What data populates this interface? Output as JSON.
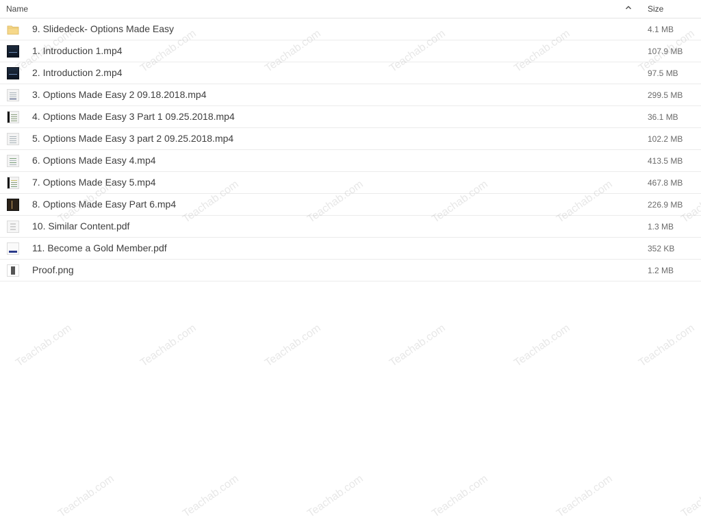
{
  "header": {
    "name_label": "Name",
    "size_label": "Size",
    "sort_icon": "chevron-up-icon"
  },
  "files": [
    {
      "name": "9. Slidedeck- Options Made Easy",
      "size": "4.1 MB",
      "icon": "folder-icon"
    },
    {
      "name": "1. Introduction 1.mp4",
      "size": "107.9 MB",
      "icon": "video-thumbnail-icon"
    },
    {
      "name": "2. Introduction 2.mp4",
      "size": "97.5 MB",
      "icon": "video-thumbnail-icon"
    },
    {
      "name": "3. Options Made Easy 2 09.18.2018.mp4",
      "size": "299.5 MB",
      "icon": "video-thumbnail-icon"
    },
    {
      "name": "4. Options Made Easy 3 Part 1 09.25.2018.mp4",
      "size": "36.1 MB",
      "icon": "video-thumbnail-icon"
    },
    {
      "name": "5. Options Made Easy 3 part 2 09.25.2018.mp4",
      "size": "102.2 MB",
      "icon": "video-thumbnail-icon"
    },
    {
      "name": "6. Options Made Easy 4.mp4",
      "size": "413.5 MB",
      "icon": "video-thumbnail-icon"
    },
    {
      "name": "7. Options Made Easy 5.mp4",
      "size": "467.8 MB",
      "icon": "video-thumbnail-icon"
    },
    {
      "name": "8. Options Made Easy Part 6.mp4",
      "size": "226.9 MB",
      "icon": "video-thumbnail-icon"
    },
    {
      "name": "10. Similar Content.pdf",
      "size": "1.3 MB",
      "icon": "pdf-thumbnail-icon"
    },
    {
      "name": "11. Become a Gold Member.pdf",
      "size": "352 KB",
      "icon": "pdf-thumbnail-icon"
    },
    {
      "name": "Proof.png",
      "size": "1.2 MB",
      "icon": "image-thumbnail-icon"
    }
  ],
  "watermark": {
    "text": "Teachab.com"
  }
}
